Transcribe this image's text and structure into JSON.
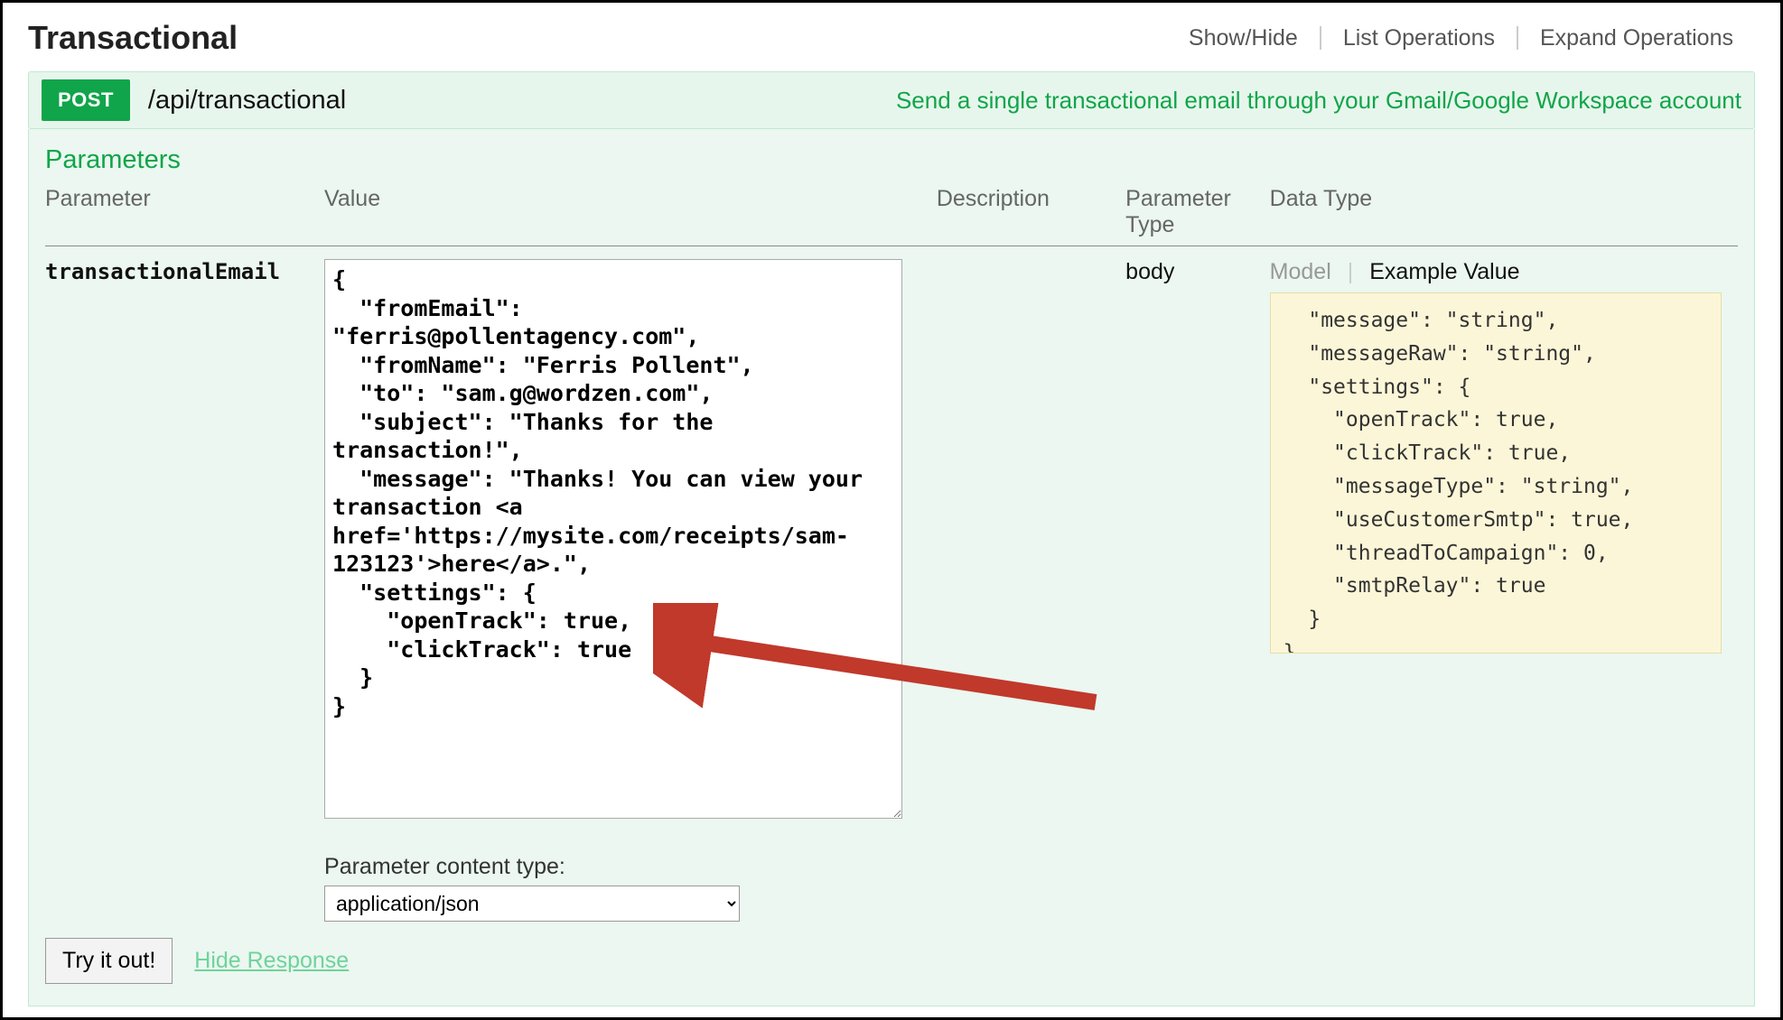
{
  "header": {
    "title": "Transactional",
    "links": {
      "show_hide": "Show/Hide",
      "list_ops": "List Operations",
      "expand_ops": "Expand Operations"
    }
  },
  "endpoint": {
    "method": "POST",
    "path": "/api/transactional",
    "description": "Send a single transactional email through your Gmail/Google Workspace account"
  },
  "parameters": {
    "section_title": "Parameters",
    "columns": {
      "parameter": "Parameter",
      "value": "Value",
      "description": "Description",
      "parameter_type": "Parameter\nType",
      "data_type": "Data Type"
    },
    "row": {
      "name": "transactionalEmail",
      "value_json": "{\n  \"fromEmail\":\n\"ferris@pollentagency.com\",\n  \"fromName\": \"Ferris Pollent\",\n  \"to\": \"sam.g@wordzen.com\",\n  \"subject\": \"Thanks for the\ntransaction!\",\n  \"message\": \"Thanks! You can view your\ntransaction <a\nhref='https://mysite.com/receipts/sam-\n123123'>here</a>.\",\n  \"settings\": {\n    \"openTrack\": true,\n    \"clickTrack\": true\n  }\n}",
      "description": "",
      "parameter_type": "body",
      "data_type_tabs": {
        "model": "Model",
        "example": "Example Value"
      },
      "example_value": "  \"message\": \"string\",\n  \"messageRaw\": \"string\",\n  \"settings\": {\n    \"openTrack\": true,\n    \"clickTrack\": true,\n    \"messageType\": \"string\",\n    \"useCustomerSmtp\": true,\n    \"threadToCampaign\": 0,\n    \"smtpRelay\": true\n  }\n}"
    },
    "content_type": {
      "label": "Parameter content type:",
      "value": "application/json"
    }
  },
  "actions": {
    "try_it_out": "Try it out!",
    "hide_response": "Hide Response"
  }
}
